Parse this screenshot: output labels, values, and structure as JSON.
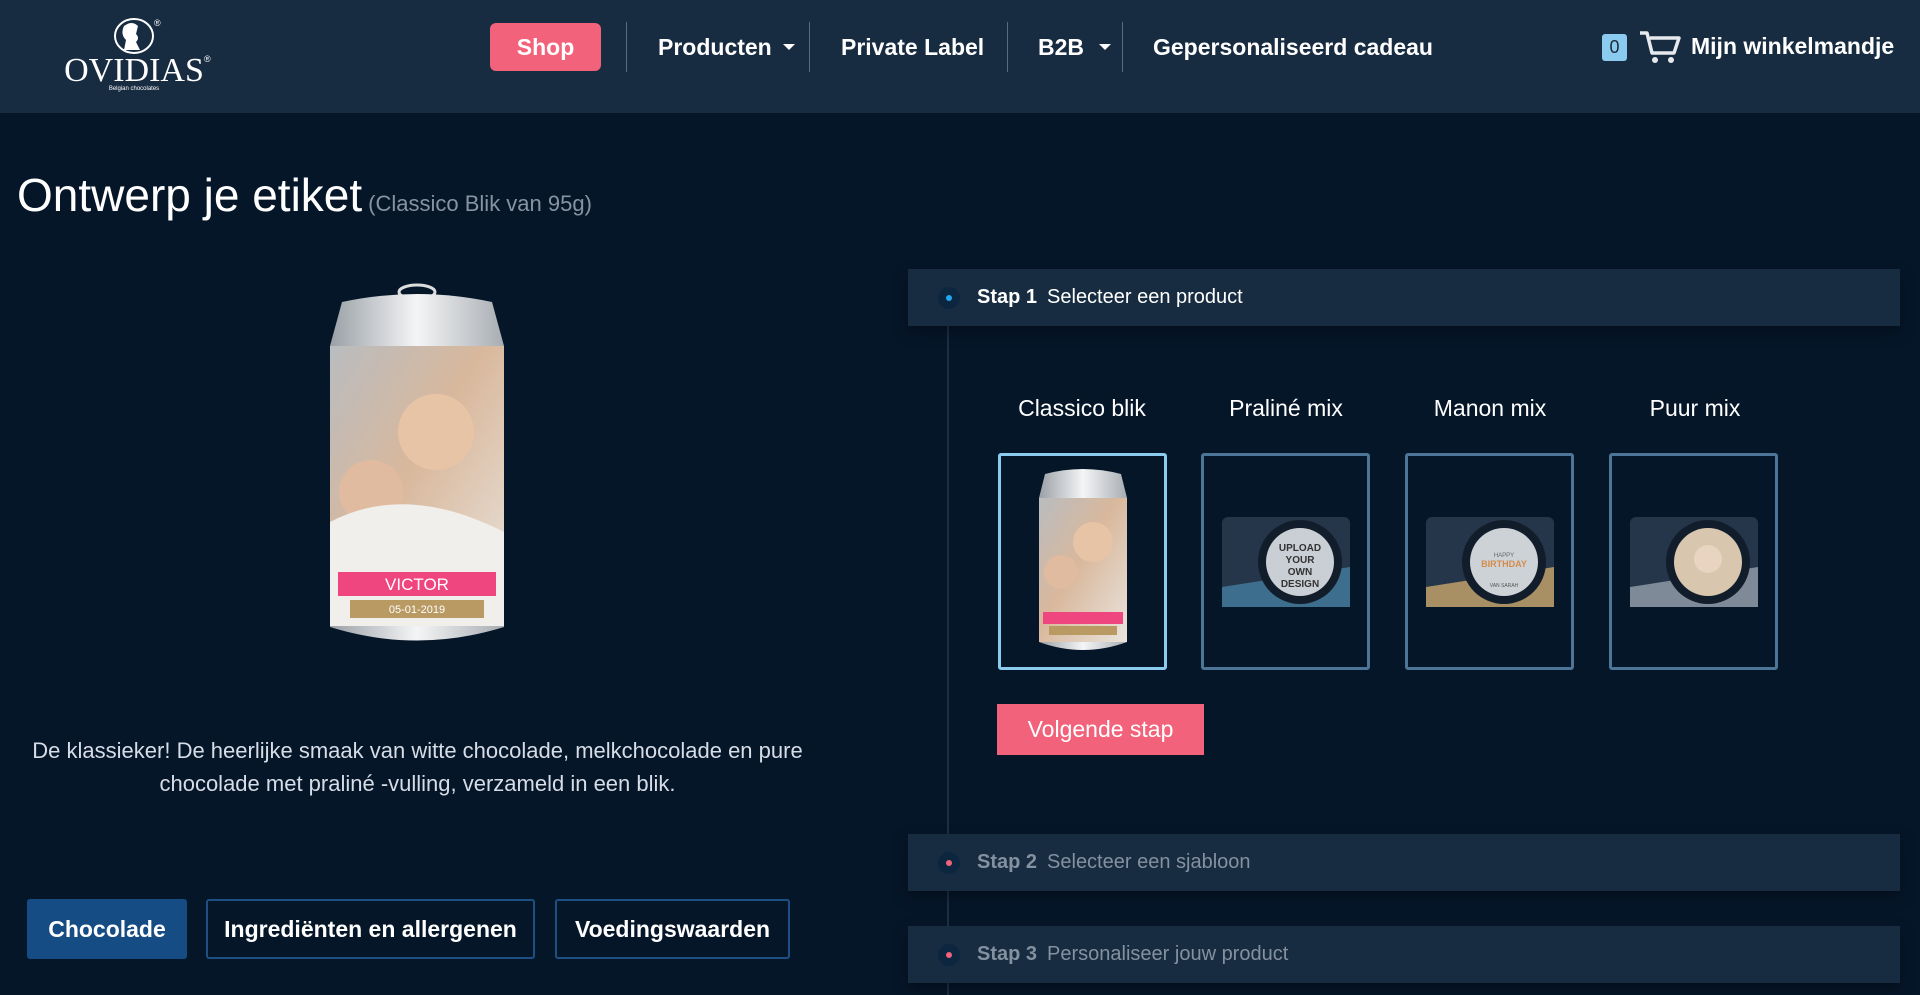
{
  "header": {
    "logo": {
      "brand": "OVIDIAS",
      "tagline": "Belgian chocolates"
    },
    "nav": [
      {
        "label": "Shop",
        "active": true
      },
      {
        "label": "Producten",
        "dropdown": true
      },
      {
        "label": "Private Label"
      },
      {
        "label": "B2B",
        "dropdown": true
      },
      {
        "label": "Gepersonaliseerd cadeau"
      }
    ],
    "cart": {
      "count": "0",
      "label": "Mijn winkelmandje",
      "icon": "cart-icon"
    }
  },
  "page": {
    "title": "Ontwerp je etiket",
    "subtitle": "(Classico Blik van 95g)",
    "preview": {
      "name": "VICTOR",
      "date": "05-01-2019"
    },
    "description": "De klassieker! De heerlijke smaak van witte chocolade, melkchocolade en pure chocolade met praliné -vulling, verzameld in een blik.",
    "tabs": [
      {
        "label": "Chocolade",
        "active": true
      },
      {
        "label": "Ingrediënten en allergenen"
      },
      {
        "label": "Voedingswaarden"
      }
    ]
  },
  "steps": [
    {
      "num": "Stap 1",
      "label": "Selecteer een product",
      "active": true
    },
    {
      "num": "Stap 2",
      "label": "Selecteer een sjabloon"
    },
    {
      "num": "Stap 3",
      "label": "Personaliseer jouw product"
    }
  ],
  "products": [
    {
      "label": "Classico blik",
      "selected": true
    },
    {
      "label": "Praliné mix",
      "box_text": [
        "UPLOAD",
        "YOUR",
        "OWN",
        "DESIGN"
      ]
    },
    {
      "label": "Manon mix",
      "box_text": [
        "HAPPY",
        "BIRTHDAY",
        "VAN SARAH"
      ]
    },
    {
      "label": "Puur mix"
    }
  ],
  "next_button": "Volgende stap",
  "colors": {
    "accent": "#f2627a",
    "header_bg": "#172b41",
    "page_bg": "#061629",
    "primary": "#154c83",
    "selected_border": "#8ccbf0"
  }
}
